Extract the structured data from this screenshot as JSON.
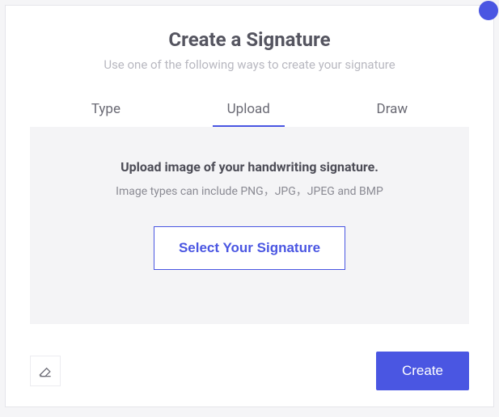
{
  "header": {
    "title": "Create a Signature",
    "subtitle": "Use one of the following ways to create your signature"
  },
  "tabs": {
    "type": "Type",
    "upload": "Upload",
    "draw": "Draw",
    "active": "upload"
  },
  "panel": {
    "heading": "Upload image of your handwriting signature.",
    "subtext": "Image types can include PNG，JPG，JPEG and BMP",
    "select_button": "Select Your Signature"
  },
  "footer": {
    "create_button": "Create"
  }
}
